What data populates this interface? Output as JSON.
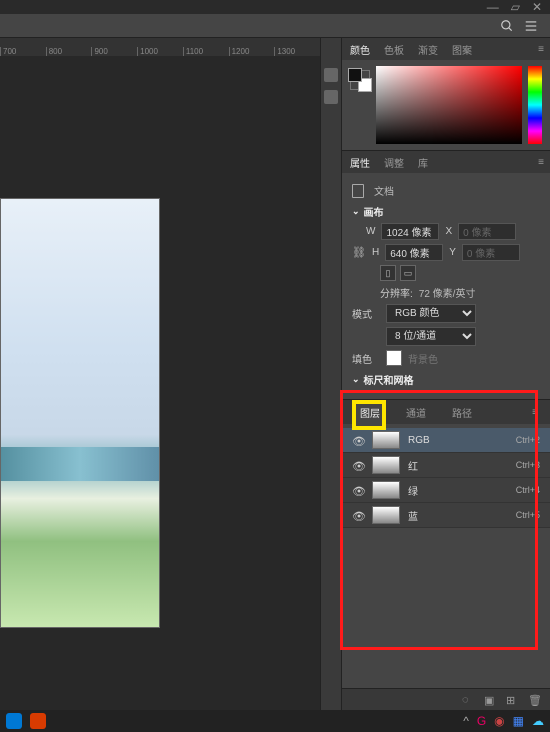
{
  "window": {
    "minimize": "—",
    "restore": "▱",
    "close": "✕"
  },
  "toolbar": {
    "search_icon": "search"
  },
  "ruler": [
    "700",
    "800",
    "900",
    "1000",
    "1100",
    "1200",
    "1300"
  ],
  "color_tabs": {
    "t1": "颜色",
    "t2": "色板",
    "t3": "渐变",
    "t4": "图案"
  },
  "prop_tabs": {
    "t1": "属性",
    "t2": "调整",
    "t3": "库"
  },
  "properties": {
    "document": "文档",
    "canvas": "画布",
    "w_label": "W",
    "w_val": "1024 像素",
    "x_label": "X",
    "x_val": "0 像素",
    "h_label": "H",
    "h_val": "640 像素",
    "y_label": "Y",
    "y_val": "0 像素",
    "res_label": "分辨率:",
    "res_val": "72 像素/英寸",
    "mode_label": "模式",
    "mode_val": "RGB 颜色",
    "depth_val": "8 位/通道",
    "fill_label": "填色",
    "fill_val": "背景色",
    "grid_section": "标尺和网格"
  },
  "channels": {
    "tabs": {
      "t1": "图层",
      "t2": "通道",
      "t3": "路径"
    },
    "rows": [
      {
        "name": "RGB",
        "key": "Ctrl+2"
      },
      {
        "name": "红",
        "key": "Ctrl+3"
      },
      {
        "name": "绿",
        "key": "Ctrl+4"
      },
      {
        "name": "蓝",
        "key": "Ctrl+5"
      }
    ]
  },
  "taskbar": {
    "apps": [
      {
        "color": "#0078d4"
      },
      {
        "color": "#d83b01"
      }
    ]
  }
}
